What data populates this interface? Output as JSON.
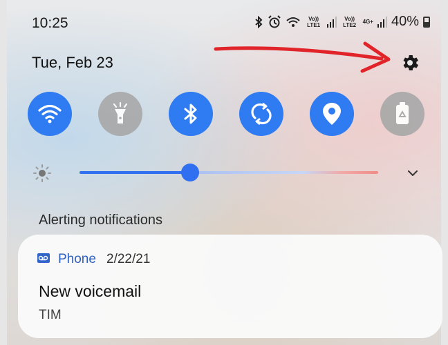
{
  "status_bar": {
    "time": "10:25",
    "sim1": "Vo)) LTE1",
    "sim2": "Vo)) LTE2",
    "network": "4G+",
    "battery_percent": "40%"
  },
  "header": {
    "date": "Tue, Feb 23",
    "settings_icon": "gear-icon"
  },
  "quick_tiles": [
    {
      "icon": "wifi-icon",
      "state": "on"
    },
    {
      "icon": "flashlight-icon",
      "state": "off"
    },
    {
      "icon": "bluetooth-icon",
      "state": "on"
    },
    {
      "icon": "auto-rotate-icon",
      "state": "on"
    },
    {
      "icon": "location-icon",
      "state": "on"
    },
    {
      "icon": "power-saving-icon",
      "state": "off"
    }
  ],
  "brightness": {
    "level": 0.37
  },
  "section": {
    "title": "Alerting notifications"
  },
  "notification": {
    "app": "Phone",
    "date": "2/22/21",
    "title": "New voicemail",
    "subtitle": "TIM"
  },
  "colors": {
    "accent": "#2f7bf2",
    "tile_off": "#a8a8a8",
    "annotation_arrow": "#e0242a",
    "app_name": "#2b5fc2"
  }
}
